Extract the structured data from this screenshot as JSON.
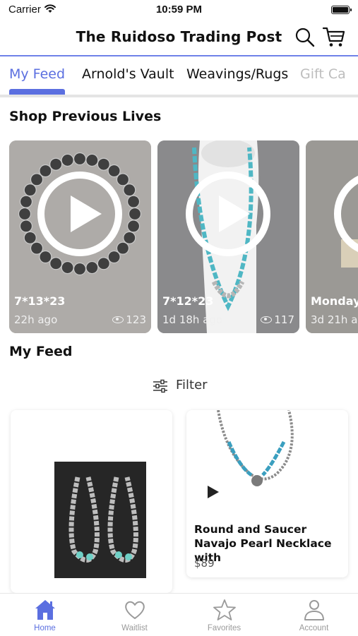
{
  "status_bar": {
    "carrier": "Carrier",
    "time": "10:59 PM"
  },
  "header": {
    "title": "The Ruidoso Trading Post",
    "search_icon": "search-icon",
    "cart_icon": "cart-icon"
  },
  "tabs": [
    {
      "label": "My Feed",
      "active": true
    },
    {
      "label": "Arnold's Vault",
      "active": false
    },
    {
      "label": "Weavings/Rugs",
      "active": false
    },
    {
      "label": "Gift Ca",
      "active": false
    }
  ],
  "previous_lives": {
    "title": "Shop Previous Lives",
    "cards": [
      {
        "date": "7*13*23",
        "ago": "22h ago",
        "views": "123"
      },
      {
        "date": "7*12*23",
        "ago": "1d 18h ago",
        "views": "117"
      },
      {
        "date": "Monday",
        "ago": "3d 21h a",
        "views": ""
      }
    ]
  },
  "feed": {
    "title": "My Feed",
    "filter_label": "Filter",
    "products": [
      {
        "name": "",
        "price": ""
      },
      {
        "name": "Round and Saucer Navajo Pearl Necklace with",
        "price": "$89"
      }
    ]
  },
  "bottom_nav": [
    {
      "label": "Home",
      "icon": "home-icon",
      "active": true
    },
    {
      "label": "Waitlist",
      "icon": "heart-icon",
      "active": false
    },
    {
      "label": "Favorites",
      "icon": "star-icon",
      "active": false
    },
    {
      "label": "Account",
      "icon": "person-icon",
      "active": false
    }
  ],
  "colors": {
    "accent": "#5b6fe0",
    "header_rule": "#6f82e8",
    "inactive": "#9a9a9a"
  }
}
